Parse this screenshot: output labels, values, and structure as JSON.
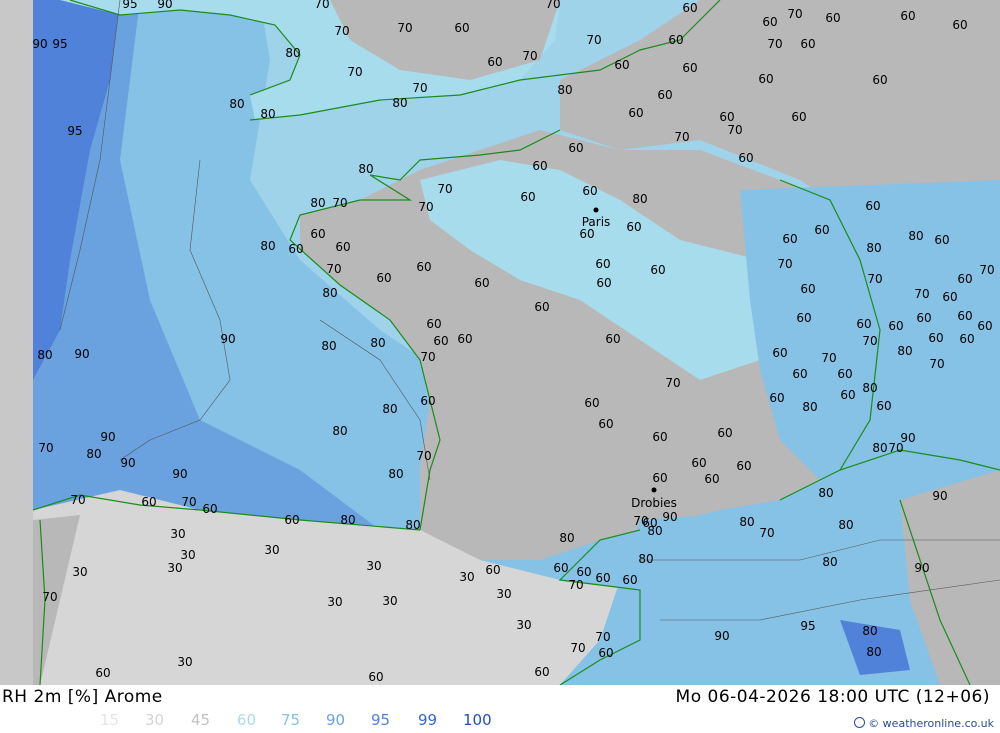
{
  "map": {
    "city_labels": [
      "Paris",
      "Drobies"
    ],
    "contour_labels": [
      {
        "text": "95"
      },
      {
        "text": "90"
      },
      {
        "text": "70"
      },
      {
        "text": "70"
      },
      {
        "text": "60"
      },
      {
        "text": "60"
      },
      {
        "text": "70"
      },
      {
        "text": "60"
      },
      {
        "text": "90"
      },
      {
        "text": "95"
      },
      {
        "text": "70"
      },
      {
        "text": "70"
      },
      {
        "text": "60"
      },
      {
        "text": "70"
      },
      {
        "text": "60"
      },
      {
        "text": "60"
      },
      {
        "text": "80"
      },
      {
        "text": "70"
      },
      {
        "text": "60"
      },
      {
        "text": "70"
      },
      {
        "text": "60"
      },
      {
        "text": "70"
      },
      {
        "text": "60"
      },
      {
        "text": "60"
      },
      {
        "text": "80"
      },
      {
        "text": "80"
      },
      {
        "text": "70"
      },
      {
        "text": "80"
      },
      {
        "text": "60"
      },
      {
        "text": "60"
      },
      {
        "text": "60"
      },
      {
        "text": "60"
      },
      {
        "text": "95"
      },
      {
        "text": "80"
      },
      {
        "text": "70"
      },
      {
        "text": "60"
      },
      {
        "text": "60"
      },
      {
        "text": "70"
      },
      {
        "text": "60"
      },
      {
        "text": "60"
      },
      {
        "text": "80"
      },
      {
        "text": "60"
      },
      {
        "text": "60"
      },
      {
        "text": "60"
      },
      {
        "text": "60"
      },
      {
        "text": "80"
      },
      {
        "text": "70"
      },
      {
        "text": "70"
      },
      {
        "text": "60"
      },
      {
        "text": "60"
      },
      {
        "text": "60"
      },
      {
        "text": "60"
      },
      {
        "text": "60"
      },
      {
        "text": "60"
      },
      {
        "text": "70"
      },
      {
        "text": "60"
      },
      {
        "text": "60"
      },
      {
        "text": "80"
      },
      {
        "text": "60"
      },
      {
        "text": "60"
      },
      {
        "text": "60"
      },
      {
        "text": "60"
      },
      {
        "text": "60"
      },
      {
        "text": "60"
      },
      {
        "text": "90"
      },
      {
        "text": "80"
      },
      {
        "text": "80"
      },
      {
        "text": "70"
      },
      {
        "text": "60"
      },
      {
        "text": "60"
      },
      {
        "text": "70"
      },
      {
        "text": "80"
      },
      {
        "text": "80"
      },
      {
        "text": "90"
      },
      {
        "text": "80"
      },
      {
        "text": "80"
      },
      {
        "text": "60"
      },
      {
        "text": "60"
      },
      {
        "text": "60"
      },
      {
        "text": "70"
      },
      {
        "text": "90"
      },
      {
        "text": "80"
      },
      {
        "text": "70"
      },
      {
        "text": "80"
      },
      {
        "text": "70"
      },
      {
        "text": "60"
      },
      {
        "text": "60"
      },
      {
        "text": "60"
      },
      {
        "text": "60"
      },
      {
        "text": "60"
      },
      {
        "text": "90"
      },
      {
        "text": "80"
      },
      {
        "text": "90"
      },
      {
        "text": "60"
      },
      {
        "text": "80"
      },
      {
        "text": "90"
      },
      {
        "text": "90"
      },
      {
        "text": "80"
      },
      {
        "text": "70"
      },
      {
        "text": "60"
      },
      {
        "text": "70"
      },
      {
        "text": "70"
      },
      {
        "text": "60"
      },
      {
        "text": "80"
      },
      {
        "text": "90"
      },
      {
        "text": "30"
      },
      {
        "text": "30"
      },
      {
        "text": "30"
      },
      {
        "text": "30"
      },
      {
        "text": "30"
      },
      {
        "text": "30"
      },
      {
        "text": "30"
      },
      {
        "text": "30"
      },
      {
        "text": "30"
      },
      {
        "text": "30"
      },
      {
        "text": "30"
      },
      {
        "text": "30"
      },
      {
        "text": "60"
      },
      {
        "text": "60"
      },
      {
        "text": "70"
      },
      {
        "text": "60"
      },
      {
        "text": "80"
      },
      {
        "text": "80"
      },
      {
        "text": "80"
      },
      {
        "text": "80"
      },
      {
        "text": "80"
      },
      {
        "text": "95"
      },
      {
        "text": "90"
      },
      {
        "text": "80"
      },
      {
        "text": "80"
      },
      {
        "text": "70"
      },
      {
        "text": "60"
      },
      {
        "text": "90"
      },
      {
        "text": "80"
      },
      {
        "text": "70"
      },
      {
        "text": "60"
      },
      {
        "text": "60"
      },
      {
        "text": "60"
      },
      {
        "text": "60"
      },
      {
        "text": "60"
      },
      {
        "text": "60"
      },
      {
        "text": "70"
      },
      {
        "text": "70"
      },
      {
        "text": "60"
      },
      {
        "text": "70"
      },
      {
        "text": "80"
      },
      {
        "text": "70"
      },
      {
        "text": "60"
      },
      {
        "text": "60"
      },
      {
        "text": "60"
      },
      {
        "text": "60"
      },
      {
        "text": "80"
      },
      {
        "text": "80"
      },
      {
        "text": "60"
      },
      {
        "text": "70"
      },
      {
        "text": "70"
      },
      {
        "text": "60"
      },
      {
        "text": "60"
      },
      {
        "text": "70"
      },
      {
        "text": "60"
      },
      {
        "text": "60"
      },
      {
        "text": "60"
      },
      {
        "text": "60"
      },
      {
        "text": "60"
      },
      {
        "text": "60"
      },
      {
        "text": "60"
      },
      {
        "text": "70"
      },
      {
        "text": "80"
      },
      {
        "text": "60"
      },
      {
        "text": "60"
      },
      {
        "text": "70"
      },
      {
        "text": "60"
      },
      {
        "text": "60"
      },
      {
        "text": "60"
      },
      {
        "text": "80"
      },
      {
        "text": "60"
      },
      {
        "text": "80"
      },
      {
        "text": "70"
      },
      {
        "text": "60"
      }
    ]
  },
  "footer": {
    "title": "RH 2m [%] Arome",
    "datetime": "Mo 06-04-2026 18:00 UTC (12+06)",
    "legend": [
      {
        "label": "15",
        "color": "#e6e6e6"
      },
      {
        "label": "30",
        "color": "#d4d4d4"
      },
      {
        "label": "45",
        "color": "#c2c2c2"
      },
      {
        "label": "60",
        "color": "#a7dcec"
      },
      {
        "label": "75",
        "color": "#86c2e6"
      },
      {
        "label": "90",
        "color": "#6aa2e0"
      },
      {
        "label": "95",
        "color": "#4f82d8"
      },
      {
        "label": "99",
        "color": "#3466cc"
      },
      {
        "label": "100",
        "color": "#1f4ec0"
      }
    ],
    "credit": "© weatheronline.co.uk"
  },
  "colors": {
    "land_grey": "#b8b8b8",
    "land_dry": "#d6d6d6",
    "sea_light": "#9fd3ea",
    "sea_mid": "#86c2e6",
    "sea_deep": "#6aa2e0",
    "sea_deepest": "#4f82d8",
    "coast": "#1a8c1a",
    "contour": "#555555",
    "label": "#000000"
  }
}
